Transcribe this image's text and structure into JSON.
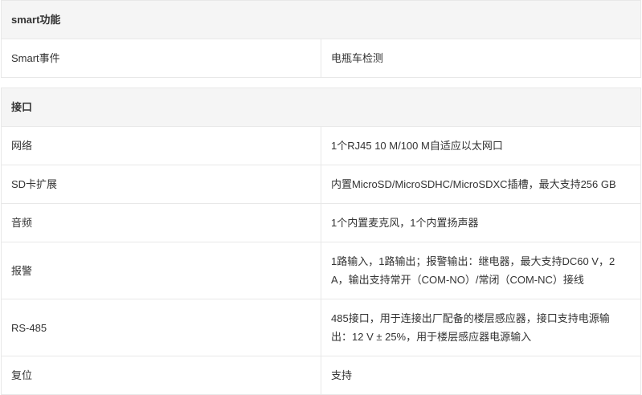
{
  "sections": [
    {
      "title": "smart功能",
      "rows": [
        {
          "label": "Smart事件",
          "value": "电瓶车检测"
        }
      ]
    },
    {
      "title": "接口",
      "rows": [
        {
          "label": "网络",
          "value": "1个RJ45 10 M/100 M自适应以太网口"
        },
        {
          "label": "SD卡扩展",
          "value": "内置MicroSD/MicroSDHC/MicroSDXC插槽，最大支持256 GB"
        },
        {
          "label": "音频",
          "value": "1个内置麦克风，1个内置扬声器"
        },
        {
          "label": "报警",
          "value": "1路输入，1路输出；报警输出：继电器，最大支持DC60 V，2 A，输出支持常开（COM-NO）/常闭（COM-NC）接线"
        },
        {
          "label": "RS-485",
          "value": "485接口，用于连接出厂配备的楼层感应器，接口支持电源输出：12 V ± 25%，用于楼层感应器电源输入"
        },
        {
          "label": "复位",
          "value": "支持"
        }
      ]
    }
  ]
}
